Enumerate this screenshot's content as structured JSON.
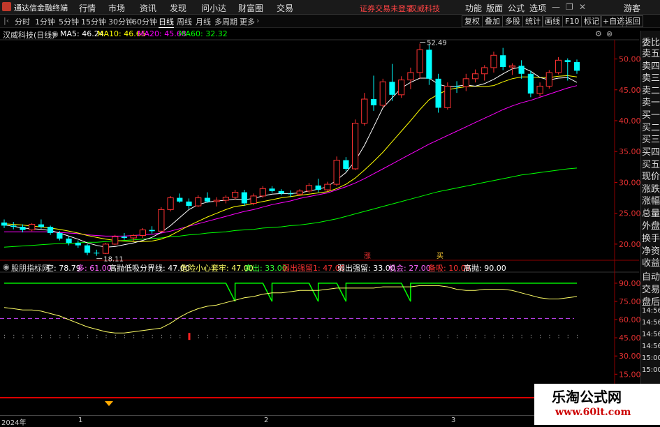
{
  "app": {
    "title": "通达信金融终端"
  },
  "menu": [
    "行情",
    "市场",
    "资讯",
    "发现",
    "问小达",
    "财富圈",
    "交易"
  ],
  "warning": "证券交易未登录",
  "stock_name_top": "汉威科技",
  "menu_right": [
    "功能",
    "版面",
    "公式",
    "选项"
  ],
  "guest": "游客",
  "tabs": [
    "分时",
    "1分钟",
    "5分钟",
    "15分钟",
    "30分钟",
    "60分钟",
    "日线",
    "周线",
    "月线",
    "多周期",
    "更多"
  ],
  "active_tab": "日线",
  "tools": [
    "复权",
    "叠加",
    "多股",
    "统计",
    "画线",
    "F10",
    "标记",
    "+自选",
    "返回"
  ],
  "title_row": {
    "name": "汉威科技(日线)",
    "ma5": "MA5: 46.24",
    "ma10": "MA10: 46.65",
    "ma20": "MA20: 45.68",
    "ma60": "MA60: 32.32"
  },
  "indicator_row": {
    "name": "股朋指标网",
    "items": [
      {
        "t": "空: 78.79",
        "c": "#ffffff"
      },
      {
        "t": "多: 61.00",
        "c": "#ff66ff"
      },
      {
        "t": "高抛低吸分界线: 47.00",
        "c": "#ffffff"
      },
      {
        "t": "危险小心套牢: 47.00",
        "c": "#ffff66"
      },
      {
        "t": "卖出: 33.00",
        "c": "#33ff33"
      },
      {
        "t": "弱出强留1: 47.00",
        "c": "#ff3333"
      },
      {
        "t": "弱出强留: 33.00",
        "c": "#ffffff"
      },
      {
        "t": "机会: 27.00",
        "c": "#ff66ff"
      },
      {
        "t": "备吸: 10.00",
        "c": "#ff3333"
      },
      {
        "t": "高抛: 90.00",
        "c": "#ffffff"
      }
    ]
  },
  "right_col": [
    "委比",
    "卖五",
    "卖四",
    "卖三",
    "卖二",
    "卖一",
    "买一",
    "买二",
    "买三",
    "买四",
    "买五",
    "现价",
    "涨跌",
    "涨幅",
    "总量",
    "外盘",
    "换手",
    "净资",
    "收益",
    "自动",
    "交易",
    "盘后",
    "14:56",
    "14:56",
    "14:56",
    "14:56",
    "15:00",
    "15:00"
  ],
  "price_axis": [
    "50.00",
    "45.00",
    "40.00",
    "35.00",
    "30.00",
    "25.00",
    "20.00"
  ],
  "ind_axis": [
    "90.00",
    "75.00",
    "60.00",
    "45.00",
    "30.00",
    "15.00"
  ],
  "annotations": {
    "high": "52.49",
    "low": "18.11",
    "mark1": "涨",
    "mark2": "买"
  },
  "dates": [
    "2024年",
    "1",
    "2",
    "3"
  ],
  "watermark": {
    "line1": "乐淘公式网",
    "line2": "www.60lt.com"
  },
  "colors": {
    "up": "#ff3232",
    "down": "#00ffff",
    "ma5": "#ffffff",
    "ma10": "#ffff00",
    "ma20": "#ff00ff",
    "ma60": "#00ff00"
  },
  "chart_data": {
    "type": "candlestick",
    "candles": [
      [
        23.5,
        24,
        22.6,
        23
      ],
      [
        23,
        23.6,
        22.4,
        22.8
      ],
      [
        22.8,
        23.2,
        21.9,
        22.3
      ],
      [
        22.3,
        23.4,
        22.1,
        23.2
      ],
      [
        23.2,
        24,
        22.5,
        22.8
      ],
      [
        22.8,
        23,
        21.5,
        21.8
      ],
      [
        21.8,
        22.1,
        20.6,
        20.9
      ],
      [
        20.9,
        21.2,
        19.8,
        20.2
      ],
      [
        20.2,
        20.6,
        19.4,
        19.8
      ],
      [
        19.8,
        20,
        18.2,
        18.6
      ],
      [
        18.6,
        19.1,
        18.11,
        18.5
      ],
      [
        18.5,
        20.2,
        18.4,
        20
      ],
      [
        20,
        21.5,
        19.8,
        21.2
      ],
      [
        21.2,
        21.8,
        20.7,
        21
      ],
      [
        21,
        21.6,
        20.5,
        21.4
      ],
      [
        21.4,
        22.6,
        21,
        22.3
      ],
      [
        22.3,
        22.9,
        21.7,
        22.1
      ],
      [
        22.1,
        26,
        21.9,
        25.6
      ],
      [
        25.6,
        27.8,
        25.3,
        27.5
      ],
      [
        27.5,
        28.2,
        26.7,
        26.9
      ],
      [
        26.9,
        27.4,
        25.7,
        26.2
      ],
      [
        26.2,
        27.9,
        26,
        27.5
      ],
      [
        27.5,
        28.4,
        26.7,
        26.9
      ],
      [
        26.9,
        27.6,
        26.1,
        27.1
      ],
      [
        27.1,
        27.9,
        26.6,
        27.6
      ],
      [
        27.6,
        28.8,
        27.2,
        28.4
      ],
      [
        28.4,
        28.8,
        26.2,
        26.6
      ],
      [
        26.6,
        28.2,
        26.3,
        27.8
      ],
      [
        27.8,
        29.4,
        27.5,
        29
      ],
      [
        29,
        29.4,
        28.3,
        28.6
      ],
      [
        28.6,
        28.9,
        27.9,
        28.2
      ],
      [
        28.2,
        28.7,
        27.6,
        28.1
      ],
      [
        28.1,
        28.9,
        27.8,
        28.6
      ],
      [
        28.6,
        29.9,
        28.3,
        29.5
      ],
      [
        29.5,
        30.6,
        28.4,
        28.8
      ],
      [
        28.8,
        30.1,
        28.5,
        29.7
      ],
      [
        29.7,
        34.2,
        29.4,
        33.6
      ],
      [
        33.6,
        34.1,
        31.8,
        32.2
      ],
      [
        32.2,
        40.2,
        32,
        39.6
      ],
      [
        39.6,
        44.5,
        39.2,
        43.5
      ],
      [
        43.5,
        47.3,
        41.6,
        42.5
      ],
      [
        42.5,
        46.8,
        42.1,
        46.3
      ],
      [
        46.3,
        49.2,
        43.2,
        44.2
      ],
      [
        44.2,
        47.2,
        43.7,
        46.6
      ],
      [
        46.6,
        48.6,
        45.1,
        47.8
      ],
      [
        47.8,
        52.49,
        46.8,
        51.5
      ],
      [
        51.5,
        52.3,
        45.8,
        46.8
      ],
      [
        46.8,
        47.6,
        41.3,
        42.1
      ],
      [
        42.1,
        46.2,
        41.8,
        45.6
      ],
      [
        45.6,
        46.4,
        44.5,
        45.5
      ],
      [
        45.5,
        47.6,
        44.8,
        46.8
      ],
      [
        46.8,
        48.3,
        46.2,
        47.6
      ],
      [
        47.6,
        49,
        46.5,
        48.6
      ],
      [
        48.6,
        51.2,
        47.8,
        50.6
      ],
      [
        50.6,
        51.8,
        48.2,
        48.7
      ],
      [
        48.7,
        49.3,
        47.4,
        48.9
      ],
      [
        48.9,
        49.8,
        46.8,
        47.6
      ],
      [
        47.6,
        48.1,
        43.8,
        44.4
      ],
      [
        44.4,
        46.2,
        43.9,
        45.6
      ],
      [
        45.6,
        48.2,
        45.2,
        47.8
      ],
      [
        47.8,
        50.3,
        47.5,
        49.8
      ],
      [
        49.8,
        50.1,
        46.5,
        49.5
      ],
      [
        49.5,
        49.9,
        47.6,
        48.1
      ]
    ],
    "price_range": [
      17.5,
      53
    ],
    "ma_lines": {
      "ma5": [
        23.1,
        22.9,
        22.6,
        22.5,
        22.4,
        22.2,
        21.8,
        21.3,
        20.8,
        20.2,
        19.8,
        19.5,
        19.6,
        19.9,
        20.2,
        20.6,
        21.1,
        21.9,
        23,
        24.3,
        25.6,
        26.4,
        26.8,
        27,
        27.1,
        27.3,
        27.2,
        27.4,
        27.8,
        28.1,
        28.2,
        28.2,
        28.3,
        28.6,
        28.9,
        29.3,
        30.4,
        31.6,
        33.5,
        36,
        39,
        42.1,
        43.7,
        45.3,
        46.2,
        46.9,
        46.9,
        45.9,
        45.5,
        45.6,
        45.8,
        45.6,
        46,
        46.7,
        47.6,
        48.4,
        48.7,
        48,
        47,
        46.6,
        46.9,
        47,
        46.2
      ],
      "ma10": [
        23.3,
        23.2,
        23.1,
        22.9,
        22.8,
        22.6,
        22.4,
        22.1,
        21.8,
        21.4,
        21.1,
        20.8,
        20.6,
        20.5,
        20.4,
        20.4,
        20.5,
        20.8,
        21.4,
        22.2,
        23,
        23.7,
        24.4,
        25,
        25.6,
        26.1,
        26.3,
        26.6,
        26.9,
        27.2,
        27.5,
        27.7,
        27.9,
        28.1,
        28.3,
        28.5,
        29,
        29.7,
        30.7,
        32,
        33.4,
        34.9,
        36.6,
        38.3,
        40,
        41.8,
        43.4,
        44.3,
        45,
        45.3,
        45.5,
        45.6,
        45.5,
        45.7,
        46.3,
        46.8,
        47.1,
        47.1,
        47,
        47,
        47.2,
        47.3,
        47.1
      ],
      "ma20": [
        22,
        22,
        22,
        22,
        22,
        22,
        21.9,
        21.8,
        21.7,
        21.5,
        21.4,
        21.3,
        21.3,
        21.3,
        21.4,
        21.5,
        21.6,
        21.8,
        22.1,
        22.5,
        22.9,
        23.3,
        23.7,
        24.1,
        24.5,
        24.9,
        25.3,
        25.6,
        26,
        26.4,
        26.7,
        27,
        27.4,
        27.7,
        28,
        28.3,
        28.8,
        29.3,
        29.9,
        30.6,
        31.4,
        32.2,
        33,
        33.8,
        34.6,
        35.4,
        36.2,
        36.9,
        37.6,
        38.3,
        39,
        39.7,
        40.4,
        41.1,
        41.8,
        42.4,
        42.9,
        43.3,
        43.8,
        44.3,
        44.8,
        45.3,
        45.68
      ],
      "ma60": [
        19.5,
        19.6,
        19.7,
        19.8,
        19.9,
        20,
        20.1,
        20.1,
        20.2,
        20.3,
        20.3,
        20.4,
        20.5,
        20.6,
        20.7,
        20.8,
        20.9,
        21,
        21.2,
        21.3,
        21.5,
        21.6,
        21.8,
        21.9,
        22,
        22.2,
        22.3,
        22.4,
        22.6,
        22.7,
        22.8,
        23,
        23.1,
        23.3,
        23.5,
        23.8,
        24.1,
        24.5,
        24.9,
        25.3,
        25.7,
        26.1,
        26.5,
        26.9,
        27.3,
        27.7,
        28.1,
        28.5,
        28.8,
        29.1,
        29.4,
        29.7,
        30,
        30.3,
        30.6,
        30.9,
        31.2,
        31.4,
        31.6,
        31.8,
        32,
        32.2,
        32.32
      ]
    },
    "indicator": {
      "range": [
        10,
        98
      ],
      "yellow": [
        70,
        69,
        68,
        68,
        67,
        65,
        63,
        60,
        57,
        54,
        52,
        50,
        49,
        49,
        50,
        51,
        52,
        53,
        57,
        62,
        66,
        69,
        71,
        72,
        74,
        76,
        78,
        79,
        81,
        82,
        82,
        83,
        84,
        84,
        84,
        85,
        86,
        86,
        86,
        86,
        86,
        87,
        87,
        87,
        87,
        88,
        88,
        88,
        87,
        85,
        84,
        84,
        85,
        85,
        85,
        84,
        82,
        80,
        78,
        77,
        77,
        78,
        79
      ],
      "green": 90,
      "green_dips": [
        [
          25,
          26
        ],
        [
          29,
          30
        ],
        [
          34,
          35
        ],
        [
          37,
          38
        ],
        [
          44,
          45
        ]
      ],
      "dip_value": 75,
      "purple": 61,
      "dots": 47
    }
  }
}
